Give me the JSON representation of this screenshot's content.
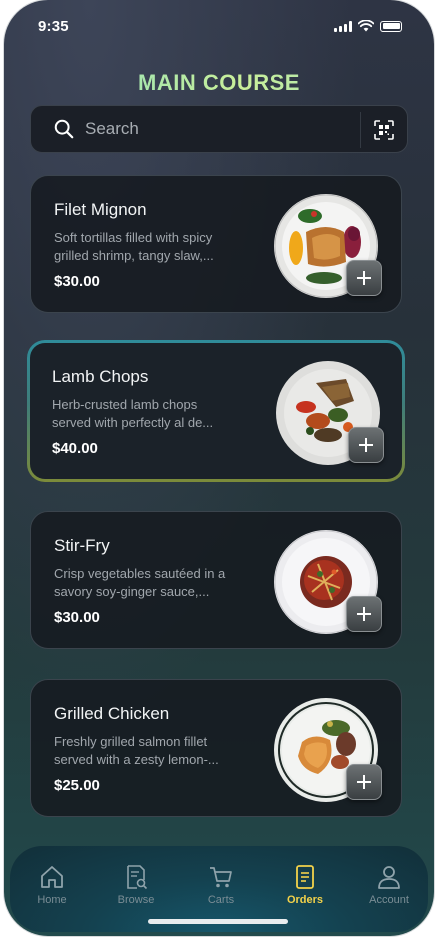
{
  "status": {
    "time": "9:35"
  },
  "page": {
    "title": "MAIN COURSE"
  },
  "search": {
    "placeholder": "Search"
  },
  "items": [
    {
      "name": "Filet Mignon",
      "description": "Soft tortillas filled with spicy grilled shrimp, tangy slaw,...",
      "price": "$30.00",
      "selected": false
    },
    {
      "name": "Lamb Chops",
      "description": "Herb-crusted lamb chops served with perfectly al de...",
      "price": "$40.00",
      "selected": true
    },
    {
      "name": "Stir-Fry",
      "description": "Crisp vegetables sautéed in a savory soy-ginger sauce,...",
      "price": "$30.00",
      "selected": false
    },
    {
      "name": "Grilled Chicken",
      "description": "Freshly grilled salmon fillet served with a zesty lemon-...",
      "price": "$25.00",
      "selected": false
    }
  ],
  "nav": {
    "items": [
      {
        "label": "Home",
        "icon": "home-icon",
        "active": false
      },
      {
        "label": "Browse",
        "icon": "browse-icon",
        "active": false
      },
      {
        "label": "Carts",
        "icon": "cart-icon",
        "active": false
      },
      {
        "label": "Orders",
        "icon": "orders-icon",
        "active": true
      },
      {
        "label": "Account",
        "icon": "account-icon",
        "active": false
      }
    ]
  },
  "colors": {
    "accent": "#f3d24a",
    "title_gradient_start": "#7fdcc4",
    "title_gradient_end": "#c9ef9a",
    "selected_border_top": "#2f8c9a",
    "selected_border_bottom": "#7c8b3a"
  }
}
